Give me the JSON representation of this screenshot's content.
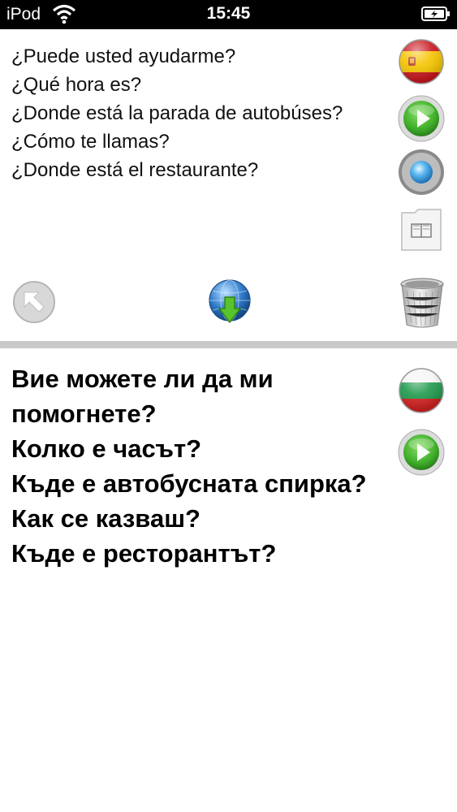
{
  "status_bar": {
    "carrier": "iPod",
    "time": "15:45",
    "wifi_icon": "wifi-icon",
    "battery_icon": "battery-charging-icon"
  },
  "source": {
    "language_flag": "spain-flag-icon",
    "sentences": [
      "¿Puede usted ayudarme?",
      "¿Qué hora es?",
      "¿Donde está la parada de autobúses?",
      "¿Cómo te llamas?",
      "¿Donde está el restaurante?"
    ]
  },
  "target": {
    "language_flag": "bulgaria-flag-icon",
    "sentences": [
      "Вие можете ли да ми помогнете?",
      "Колко е часът?",
      "Къде е автобусната спирка?",
      "Как се казваш?",
      "Къде е ресторантът?"
    ]
  },
  "icons": {
    "play": "play-icon",
    "record": "record-icon",
    "phrasebook": "phrasebook-icon",
    "back": "back-arrow-icon",
    "translate": "globe-download-icon",
    "trash": "trash-icon"
  },
  "colors": {
    "play_green": "#3fae2a",
    "divider": "#c9c9c9",
    "globe_blue": "#2f79c9"
  }
}
